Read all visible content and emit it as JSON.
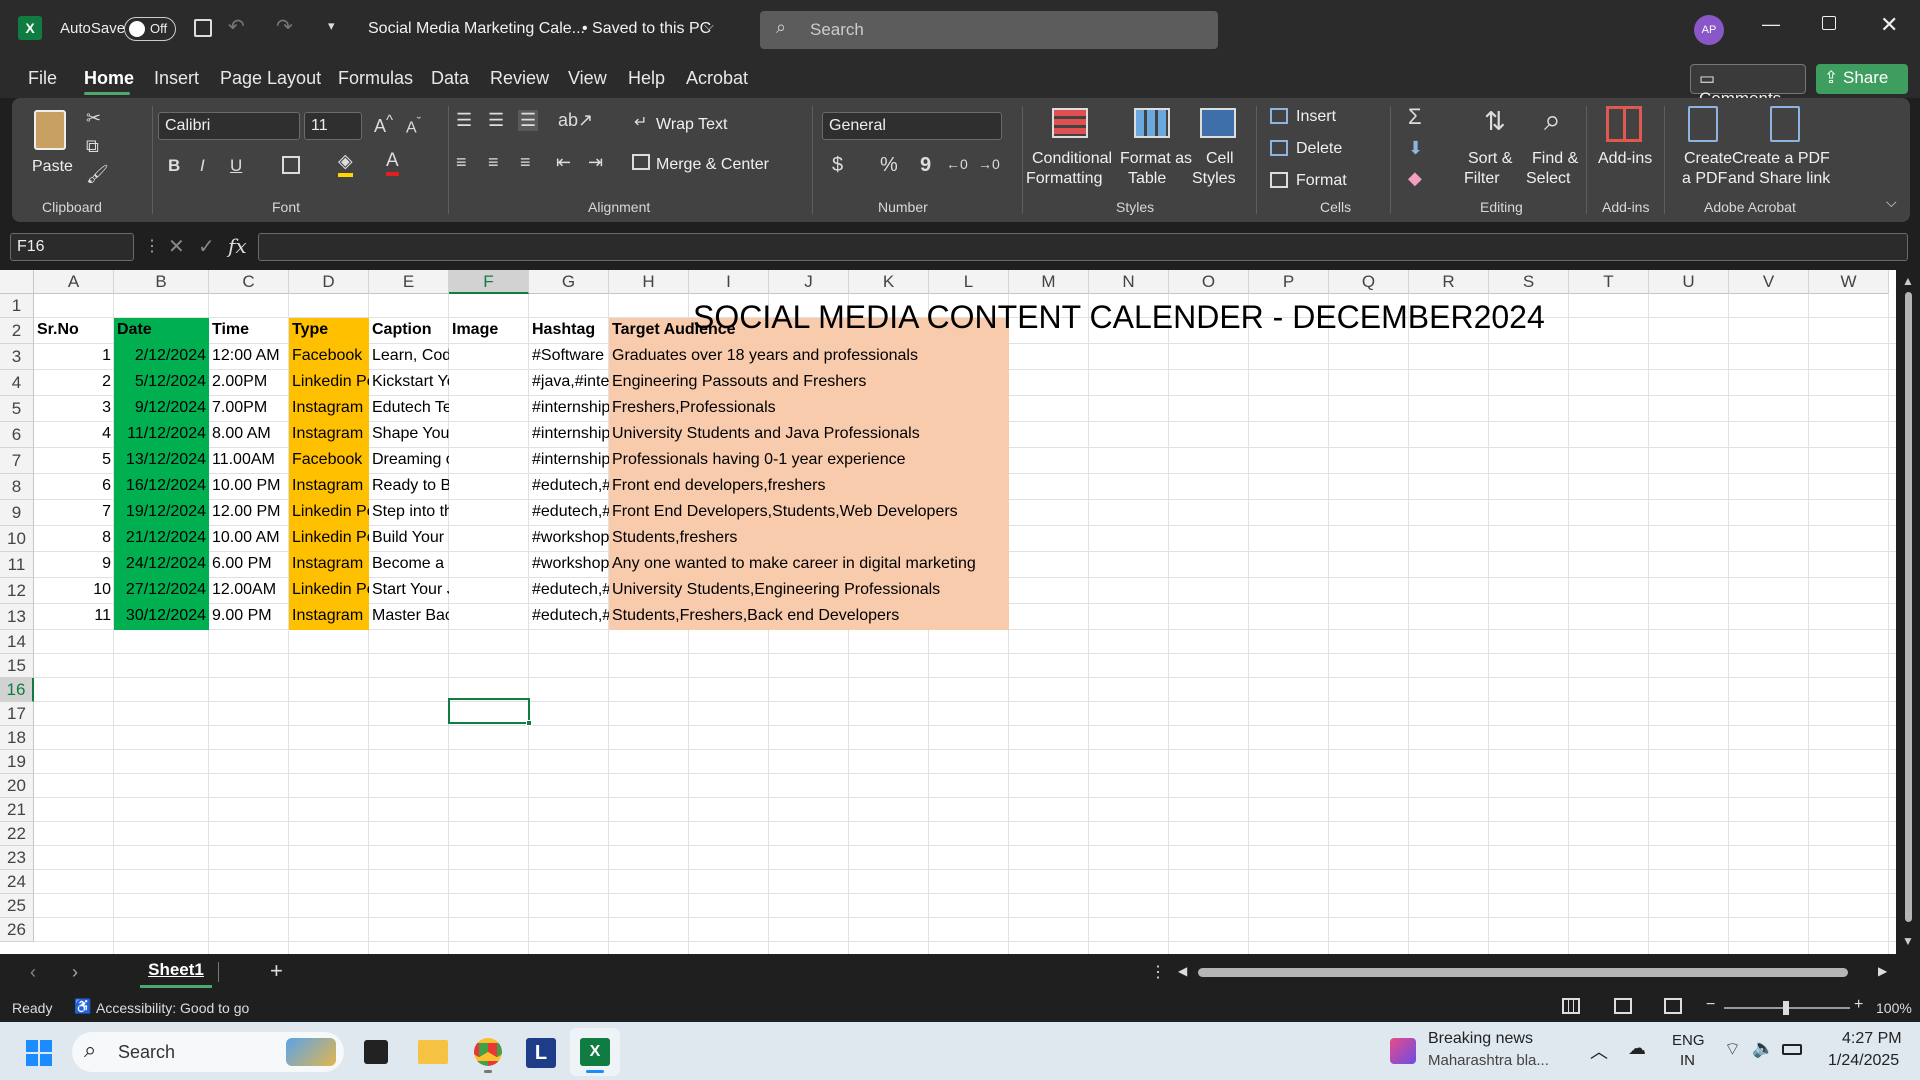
{
  "titlebar": {
    "autosave": "AutoSave",
    "toggle": "Off",
    "doc_title": "Social Media Marketing Cale...",
    "saved": "• Saved to this PC",
    "search_placeholder": "Search",
    "avatar": "AP"
  },
  "tabs": [
    "File",
    "Home",
    "Insert",
    "Page Layout",
    "Formulas",
    "Data",
    "Review",
    "View",
    "Help",
    "Acrobat"
  ],
  "buttons": {
    "comments": "Comments",
    "share": "Share"
  },
  "ribbon": {
    "clipboard": {
      "paste": "Paste",
      "group": "Clipboard"
    },
    "font": {
      "name": "Calibri",
      "size": "11",
      "group": "Font",
      "bold": "B",
      "italic": "I",
      "underline": "U"
    },
    "alignment": {
      "wrap": "Wrap Text",
      "merge": "Merge & Center",
      "group": "Alignment"
    },
    "number": {
      "format": "General",
      "group": "Number",
      "currency": "$",
      "percent": "%",
      "comma": "9"
    },
    "styles": {
      "cond1": "Conditional",
      "cond2": "Formatting",
      "fmt1": "Format as",
      "fmt2": "Table",
      "cell1": "Cell",
      "cell2": "Styles",
      "group": "Styles"
    },
    "cells": {
      "insert": "Insert",
      "delete": "Delete",
      "format": "Format",
      "group": "Cells"
    },
    "editing": {
      "sort1": "Sort &",
      "sort2": "Filter",
      "find1": "Find &",
      "find2": "Select",
      "group": "Editing"
    },
    "addins": {
      "label": "Add-ins",
      "group": "Add-ins"
    },
    "acrobat": {
      "create1": "Create",
      "create2": "a PDF",
      "share1": "Create a PDF",
      "share2": "and Share link",
      "group": "Adobe Acrobat"
    }
  },
  "formula_bar": {
    "name_box": "F16",
    "fx": "fx",
    "content": ""
  },
  "columns": [
    "A",
    "B",
    "C",
    "D",
    "E",
    "F",
    "G",
    "H",
    "I",
    "J",
    "K",
    "L",
    "M",
    "N",
    "O",
    "P",
    "Q",
    "R",
    "S",
    "T",
    "U",
    "V",
    "W"
  ],
  "rows": [
    "1",
    "2",
    "3",
    "4",
    "5",
    "6",
    "7",
    "8",
    "9",
    "10",
    "11",
    "12",
    "13",
    "14",
    "15",
    "16",
    "17",
    "18",
    "19",
    "20",
    "21",
    "22",
    "23",
    "24",
    "25",
    "26"
  ],
  "sheet": {
    "title": "SOCIAL MEDIA CONTENT CALENDER - DECEMBER2024",
    "headers": [
      "Sr.No",
      "Date",
      "Time",
      "Type",
      "Caption",
      "Image",
      "Hashtag",
      "Target Audience"
    ],
    "data": [
      [
        "1",
        "2/12/2024",
        "12:00 AM",
        "Facebook",
        "Learn, Code, and Grow",
        "",
        "#Software",
        "Graduates over 18  years and professionals"
      ],
      [
        "2",
        "5/12/2024",
        "2.00PM",
        "Linkedin Post",
        "Kickstart Your Career",
        "",
        "#java,#internship",
        "Engineering Passouts and Freshers"
      ],
      [
        "3",
        "9/12/2024",
        "7.00PM",
        "Instagram",
        "Edutech Technologies",
        "",
        "#internship",
        "Freshers,Professionals"
      ],
      [
        "4",
        "11/12/2024",
        "8.00 AM",
        "Instagram",
        "Shape Your Future with",
        "",
        "#internship",
        "University Students  and Java Professionals"
      ],
      [
        "5",
        "13/12/2024",
        "11.00AM",
        "Facebook",
        "Dreaming of a Career",
        "",
        "#internship",
        "Professionals having 0-1 year experience"
      ],
      [
        "6",
        "16/12/2024",
        "10.00 PM",
        "Instagram",
        "Ready to Build Amazing",
        "",
        "#edutech,#",
        "Front end developers,freshers"
      ],
      [
        "7",
        "19/12/2024",
        "12.00 PM",
        "Linkedin Post",
        "Step into the Future of",
        "",
        "#edutech,#",
        "Front End Developers,Students,Web Developers"
      ],
      [
        "8",
        "21/12/2024",
        "10.00 AM",
        "Linkedin Post",
        "Build Your Digital Marketing",
        "",
        "#workshop",
        "Students,freshers"
      ],
      [
        "9",
        "24/12/2024",
        "6.00 PM",
        "Instagram",
        "Become a Digital Marketer",
        "",
        "#workshop",
        "Any one wanted to make career in digital marketing"
      ],
      [
        "10",
        "27/12/2024",
        "12.00AM",
        "Linkedin Post",
        "Start Your Journey as",
        "",
        "#edutech,#",
        "University Students,Engineering Professionals"
      ],
      [
        "11",
        "30/12/2024",
        "9.00 PM",
        "Instagram",
        "Master Back-End Tech",
        "",
        "#edutech,#",
        "Students,Freshers,Back end Developers"
      ]
    ]
  },
  "sheet_tabs": {
    "active": "Sheet1"
  },
  "status": {
    "ready": "Ready",
    "accessibility": "Accessibility: Good to go",
    "zoom": "100%"
  },
  "taskbar": {
    "search": "Search",
    "news_title": "Breaking news",
    "news_sub": "Maharashtra bla...",
    "lang1": "ENG",
    "lang2": "IN",
    "time": "4:27 PM",
    "date": "1/24/2025"
  },
  "colors": {
    "date_fill": "#00b050",
    "type_fill": "#ffc000",
    "audience_fill": "#f8cbad",
    "excel_green": "#107c41",
    "share_green": "#3e9e5f"
  }
}
